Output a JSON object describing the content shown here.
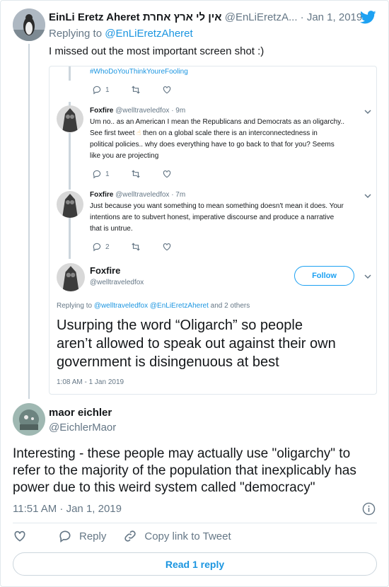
{
  "tweet": {
    "author_name": "EinLi Eretz Aheret אין לי ארץ אחרת",
    "author_handle": "@EnLiEretzA...",
    "date": "· Jan 1, 2019",
    "replying_to_prefix": "Replying to ",
    "replying_to_handle": "@EnLiEretzAheret",
    "text": "I missed out the most important screen shot :)"
  },
  "screenshot": {
    "hashtag": "#WhoDoYouThinkYoureFooling",
    "top_reply_count": "1",
    "reply1": {
      "name": "Foxfire",
      "handle_time": "@welltraveledfox · 9m",
      "text_a": "Um no.. as an American I mean the Republicans and Democrats as an oligarchy..",
      "text_b": "See first tweet",
      "emoji": "☝",
      "text_c": "then on a global scale there is an interconnectedness in",
      "text_d": "political policies.. why does everything have to go back to that for you? Seems",
      "text_e": "like you are projecting",
      "reply_count": "1"
    },
    "reply2": {
      "name": "Foxfire",
      "handle_time": "@welltraveledfox · 7m",
      "text_a": "Just because you want something to mean something doesn't mean it does. Your",
      "text_b": "intentions are to subvert honest, imperative discourse and produce a narrative",
      "text_c": "that is untrue.",
      "reply_count": "2"
    },
    "main": {
      "name": "Foxfire",
      "handle": "@welltraveledfox",
      "follow_label": "Follow",
      "replying_prefix": "Replying to ",
      "replying_h1": "@welltraveledfox",
      "replying_h2": "@EnLiEretzAheret",
      "replying_suffix": " and 2 others",
      "line1": "Usurping the word “Oligarch” so people",
      "line2": "aren’t allowed to speak out against their own",
      "line3": "government is disingenuous at best",
      "timestamp": "1:08 AM - 1 Jan 2019"
    }
  },
  "reply_tweet": {
    "author_name": "maor eichler",
    "author_handle": "@EichlerMaor",
    "line1": "Interesting - these people may actually use \"oligarchy\" to",
    "line2": "refer to the majority of the population that inexplicably has",
    "line3": "power due to this weird system called \"democracy\"",
    "timestamp": "11:51 AM · Jan 1, 2019"
  },
  "actions": {
    "reply_label": "Reply",
    "copy_label": "Copy link to Tweet",
    "read_reply_label": "Read 1 reply"
  },
  "colors": {
    "brand": "#1da1f2",
    "link": "#1b95e0",
    "muted": "#657786",
    "border": "#e1e8ed"
  },
  "icons": [
    "twitter-bird-icon",
    "reply-icon",
    "retweet-icon",
    "heart-icon",
    "chevron-down-icon",
    "info-icon",
    "share-icon"
  ]
}
